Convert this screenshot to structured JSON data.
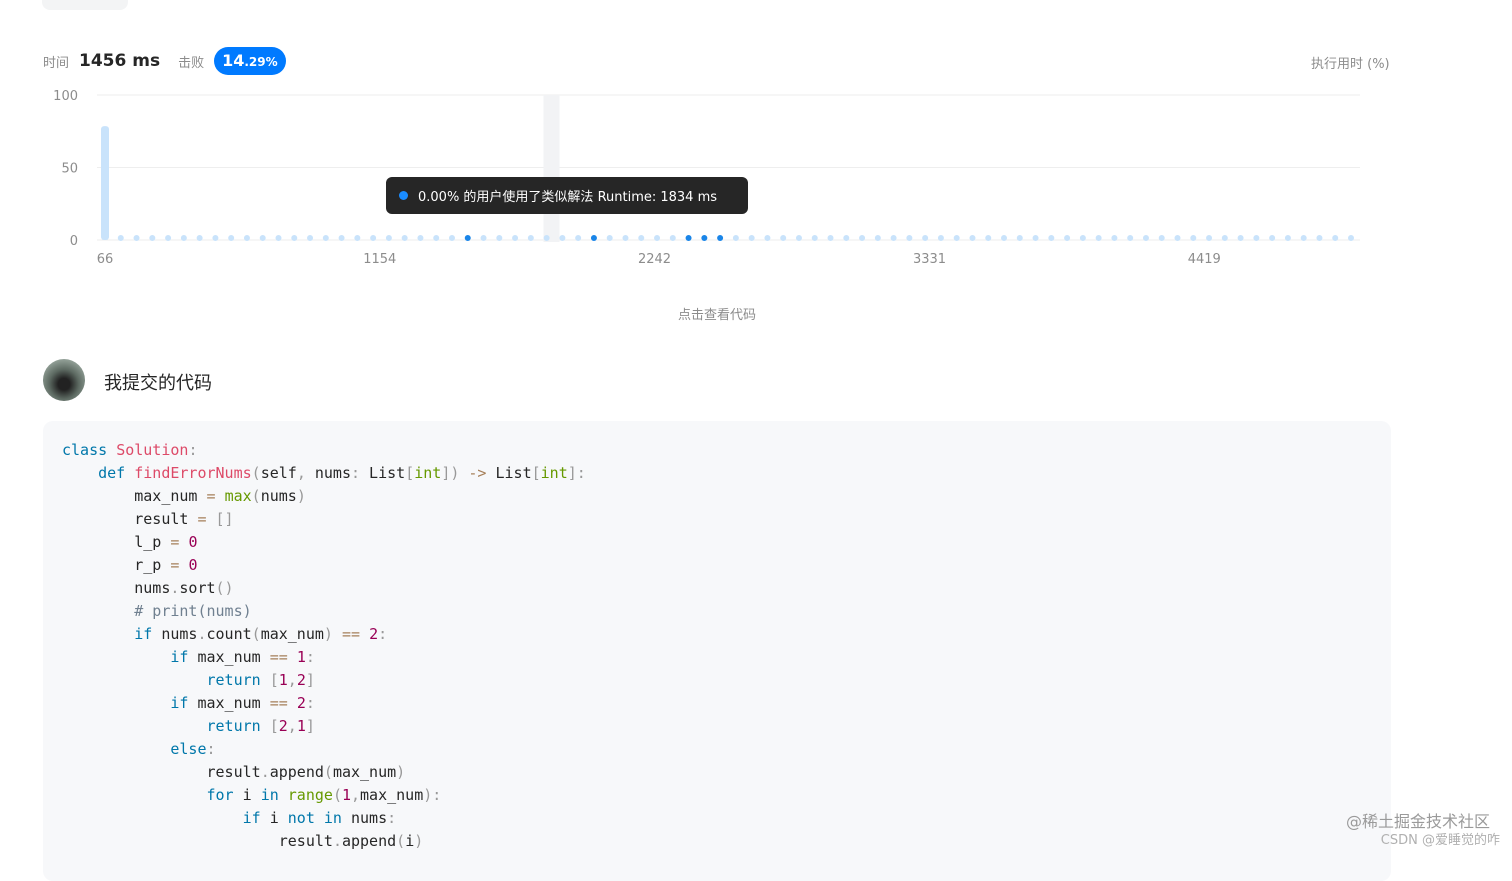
{
  "stats": {
    "time_label": "时间",
    "time_value": "1456 ms",
    "beat_label": "击败",
    "beat_int": "14",
    "beat_frac": ".29%"
  },
  "legend_right": "执行用时 (%)",
  "chart_data": {
    "type": "scatter",
    "y_ticks": [
      "100",
      "50",
      "0"
    ],
    "x_ticks": [
      "66",
      "1154",
      "2242",
      "3331",
      "4419"
    ],
    "ylim": [
      0,
      100
    ],
    "xlim": [
      66,
      5000
    ],
    "bar": {
      "x": 66,
      "y": 78.57
    },
    "highlight_x": 1834,
    "point_count": 80,
    "dark_points": [
      1520,
      2010,
      2380,
      2450,
      2520
    ],
    "accent_colors": {
      "light": "#c9e3fb",
      "dark": "#1a85e8",
      "grid": "#eeeeee",
      "band": "#f2f3f5"
    }
  },
  "tooltip": {
    "text": "0.00% 的用户使用了类似解法 Runtime: 1834 ms",
    "dot_color": "#1a8cff"
  },
  "view_code_link": "点击查看代码",
  "submission": {
    "title": "我提交的代码",
    "avatar": "avatar-image"
  },
  "code": [
    [
      [
        "kw",
        "class"
      ],
      [
        "t",
        " "
      ],
      [
        "cls",
        "Solution"
      ],
      [
        "p",
        ":"
      ]
    ],
    [
      [
        "t",
        "    "
      ],
      [
        "kw",
        "def"
      ],
      [
        "t",
        " "
      ],
      [
        "fn",
        "findErrorNums"
      ],
      [
        "p",
        "("
      ],
      [
        "t",
        "self"
      ],
      [
        "p",
        ","
      ],
      [
        "t",
        " nums"
      ],
      [
        "p",
        ":"
      ],
      [
        "t",
        " List"
      ],
      [
        "p",
        "["
      ],
      [
        "bi",
        "int"
      ],
      [
        "p",
        "])"
      ],
      [
        "t",
        " "
      ],
      [
        "op",
        "->"
      ],
      [
        "t",
        " List"
      ],
      [
        "p",
        "["
      ],
      [
        "bi",
        "int"
      ],
      [
        "p",
        "]:"
      ]
    ],
    [
      [
        "t",
        "        max_num "
      ],
      [
        "op",
        "="
      ],
      [
        "t",
        " "
      ],
      [
        "bi",
        "max"
      ],
      [
        "p",
        "("
      ],
      [
        "t",
        "nums"
      ],
      [
        "p",
        ")"
      ]
    ],
    [
      [
        "t",
        "        result "
      ],
      [
        "op",
        "="
      ],
      [
        "t",
        " "
      ],
      [
        "p",
        "[]"
      ]
    ],
    [
      [
        "t",
        "        l_p "
      ],
      [
        "op",
        "="
      ],
      [
        "t",
        " "
      ],
      [
        "num",
        "0"
      ]
    ],
    [
      [
        "t",
        "        r_p "
      ],
      [
        "op",
        "="
      ],
      [
        "t",
        " "
      ],
      [
        "num",
        "0"
      ]
    ],
    [
      [
        "t",
        "        nums"
      ],
      [
        "p",
        "."
      ],
      [
        "t",
        "sort"
      ],
      [
        "p",
        "()"
      ]
    ],
    [
      [
        "t",
        "        "
      ],
      [
        "cm",
        "# print(nums)"
      ]
    ],
    [
      [
        "t",
        "        "
      ],
      [
        "kw",
        "if"
      ],
      [
        "t",
        " nums"
      ],
      [
        "p",
        "."
      ],
      [
        "t",
        "count"
      ],
      [
        "p",
        "("
      ],
      [
        "t",
        "max_num"
      ],
      [
        "p",
        ")"
      ],
      [
        "t",
        " "
      ],
      [
        "op",
        "=="
      ],
      [
        "t",
        " "
      ],
      [
        "num",
        "2"
      ],
      [
        "p",
        ":"
      ]
    ],
    [
      [
        "t",
        "            "
      ],
      [
        "kw",
        "if"
      ],
      [
        "t",
        " max_num "
      ],
      [
        "op",
        "=="
      ],
      [
        "t",
        " "
      ],
      [
        "num",
        "1"
      ],
      [
        "p",
        ":"
      ]
    ],
    [
      [
        "t",
        "                "
      ],
      [
        "kw",
        "return"
      ],
      [
        "t",
        " "
      ],
      [
        "p",
        "["
      ],
      [
        "num",
        "1"
      ],
      [
        "p",
        ","
      ],
      [
        "num",
        "2"
      ],
      [
        "p",
        "]"
      ]
    ],
    [
      [
        "t",
        "            "
      ],
      [
        "kw",
        "if"
      ],
      [
        "t",
        " max_num "
      ],
      [
        "op",
        "=="
      ],
      [
        "t",
        " "
      ],
      [
        "num",
        "2"
      ],
      [
        "p",
        ":"
      ]
    ],
    [
      [
        "t",
        "                "
      ],
      [
        "kw",
        "return"
      ],
      [
        "t",
        " "
      ],
      [
        "p",
        "["
      ],
      [
        "num",
        "2"
      ],
      [
        "p",
        ","
      ],
      [
        "num",
        "1"
      ],
      [
        "p",
        "]"
      ]
    ],
    [
      [
        "t",
        "            "
      ],
      [
        "kw",
        "else"
      ],
      [
        "p",
        ":"
      ]
    ],
    [
      [
        "t",
        "                result"
      ],
      [
        "p",
        "."
      ],
      [
        "t",
        "append"
      ],
      [
        "p",
        "("
      ],
      [
        "t",
        "max_num"
      ],
      [
        "p",
        ")"
      ]
    ],
    [
      [
        "t",
        "                "
      ],
      [
        "kw",
        "for"
      ],
      [
        "t",
        " i "
      ],
      [
        "kw",
        "in"
      ],
      [
        "t",
        " "
      ],
      [
        "bi",
        "range"
      ],
      [
        "p",
        "("
      ],
      [
        "num",
        "1"
      ],
      [
        "p",
        ","
      ],
      [
        "t",
        "max_num"
      ],
      [
        "p",
        "):"
      ]
    ],
    [
      [
        "t",
        "                    "
      ],
      [
        "kw",
        "if"
      ],
      [
        "t",
        " i "
      ],
      [
        "kw",
        "not"
      ],
      [
        "t",
        " "
      ],
      [
        "kw",
        "in"
      ],
      [
        "t",
        " nums"
      ],
      [
        "p",
        ":"
      ]
    ],
    [
      [
        "t",
        "                        result"
      ],
      [
        "p",
        "."
      ],
      [
        "t",
        "append"
      ],
      [
        "p",
        "("
      ],
      [
        "t",
        "i"
      ],
      [
        "p",
        ")"
      ]
    ]
  ],
  "watermark": {
    "line1": "@稀土掘金技术社区",
    "line2": "CSDN @爱睡觉的咋"
  }
}
